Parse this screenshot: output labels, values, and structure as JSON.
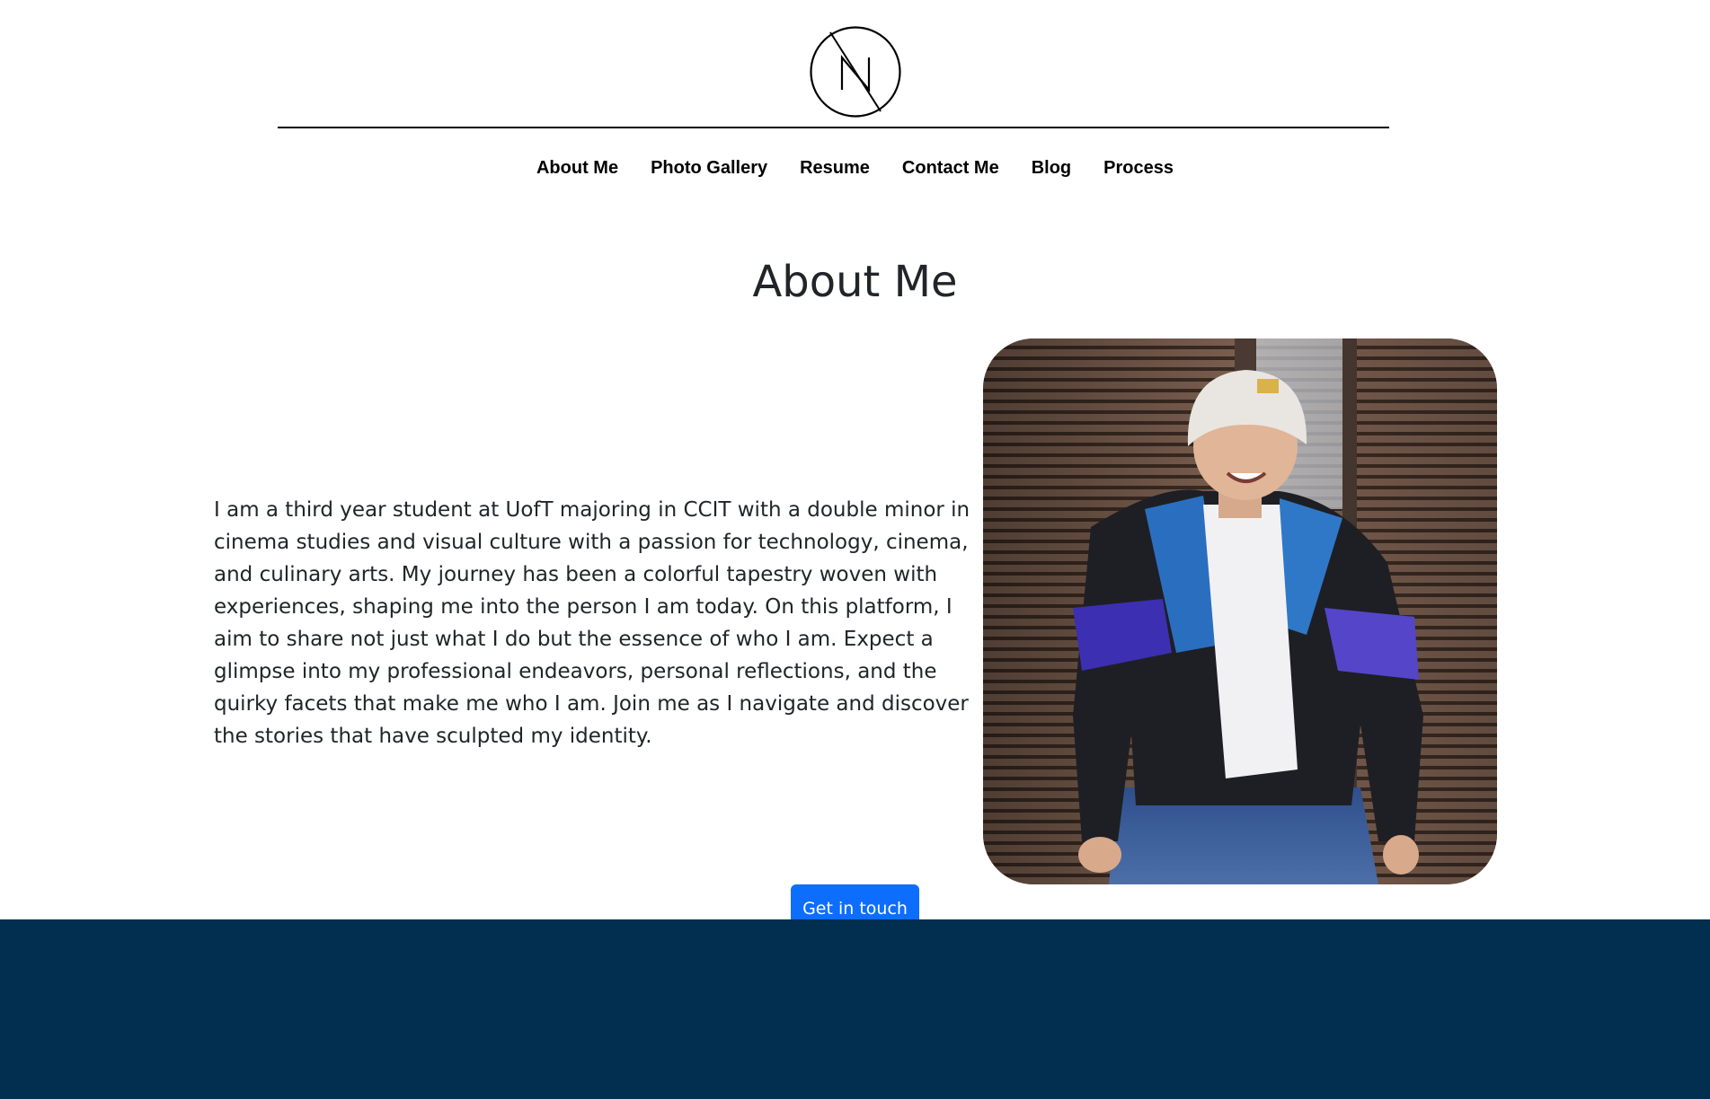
{
  "header": {
    "logo_icon": "n-circle-slash-logo"
  },
  "nav": {
    "items": [
      {
        "label": "About Me"
      },
      {
        "label": "Photo Gallery"
      },
      {
        "label": "Resume"
      },
      {
        "label": "Contact Me"
      },
      {
        "label": "Blog"
      },
      {
        "label": "Process"
      }
    ]
  },
  "main": {
    "title": "About Me",
    "intro": "I am a third year student at UofT majoring in CCIT with a double minor in cinema studies and visual culture with a passion for technology, cinema, and culinary arts. My journey has been a colorful tapestry woven with experiences, shaping me into the person I am today. On this platform, I aim to share not just what I do but the essence of who I am. Expect a glimpse into my professional endeavors, personal reflections, and the quirky facets that make me who I am. Join me as I navigate and discover the stories that have sculpted my identity.",
    "cta_label": "Get in touch"
  },
  "colors": {
    "accent": "#0d6efd",
    "footer": "#022f50",
    "text": "#212529"
  }
}
